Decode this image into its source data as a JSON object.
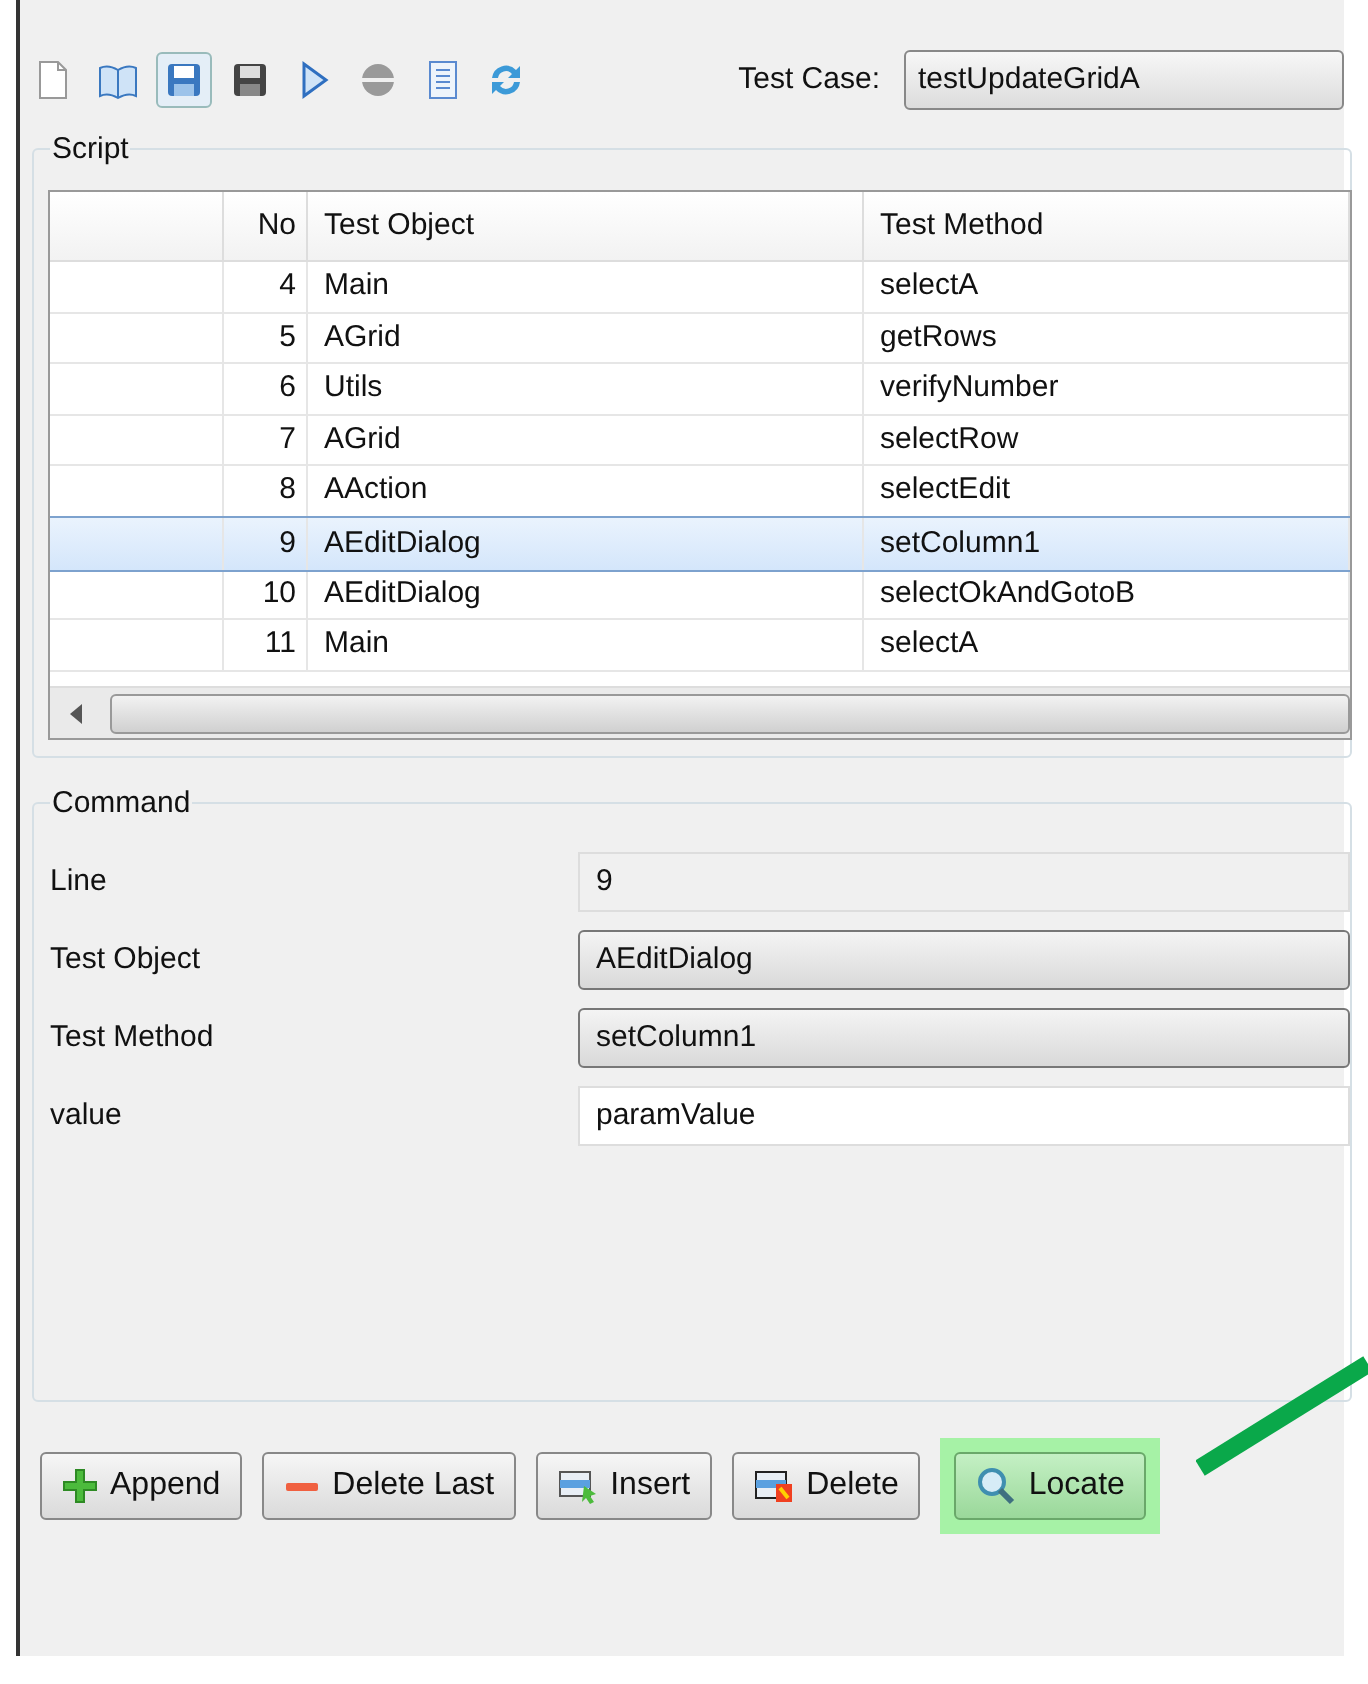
{
  "toolbar": {
    "test_case_label": "Test Case:",
    "test_case_value": "testUpdateGridA"
  },
  "script": {
    "title": "Script",
    "columns": [
      "No",
      "Test Object",
      "Test Method"
    ],
    "rows": [
      {
        "no": "4",
        "object": "Main",
        "method": "selectA",
        "selected": false
      },
      {
        "no": "5",
        "object": "AGrid",
        "method": "getRows",
        "selected": false
      },
      {
        "no": "6",
        "object": "Utils",
        "method": "verifyNumber",
        "selected": false
      },
      {
        "no": "7",
        "object": "AGrid",
        "method": "selectRow",
        "selected": false
      },
      {
        "no": "8",
        "object": "AAction",
        "method": "selectEdit",
        "selected": false
      },
      {
        "no": "9",
        "object": "AEditDialog",
        "method": "setColumn1",
        "selected": true
      },
      {
        "no": "10",
        "object": "AEditDialog",
        "method": "selectOkAndGotoB",
        "selected": false
      },
      {
        "no": "11",
        "object": "Main",
        "method": "selectA",
        "selected": false
      }
    ]
  },
  "command": {
    "title": "Command",
    "fields": [
      {
        "label": "Line",
        "value": "9",
        "kind": "readonly"
      },
      {
        "label": "Test Object",
        "value": "AEditDialog",
        "kind": "combo"
      },
      {
        "label": "Test Method",
        "value": "setColumn1",
        "kind": "combo"
      },
      {
        "label": "value",
        "value": "paramValue",
        "kind": "text"
      }
    ]
  },
  "buttons": [
    {
      "label": "Append",
      "kind": "plus",
      "highlighted": false
    },
    {
      "label": "Delete Last",
      "kind": "minus",
      "highlighted": false
    },
    {
      "label": "Insert",
      "kind": "insert",
      "highlighted": false
    },
    {
      "label": "Delete",
      "kind": "delete",
      "highlighted": false
    },
    {
      "label": "Locate",
      "kind": "search",
      "highlighted": true
    }
  ]
}
